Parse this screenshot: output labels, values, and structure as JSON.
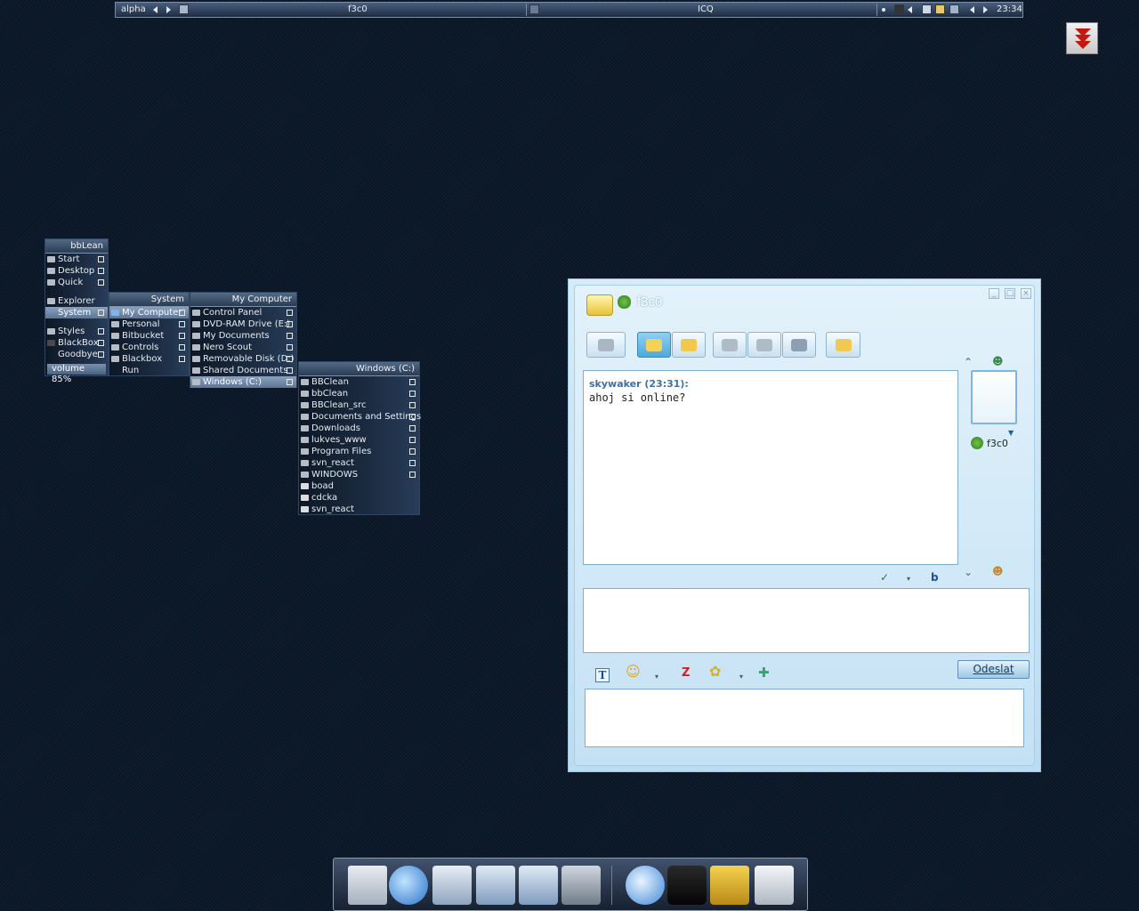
{
  "toolbar": {
    "workspace": "alpha",
    "task_title": "f3c0",
    "app_title": "ICQ",
    "clock": "23:34"
  },
  "menus": {
    "bblean": {
      "title": "bbLean",
      "items": [
        "Start",
        "Desktop",
        "Quick",
        "Explorer",
        "System",
        "Styles",
        "BlackBox",
        "Goodbye"
      ],
      "volume": "volume 85%"
    },
    "system": {
      "title": "System",
      "items": [
        "My Computer",
        "Personal",
        "Bitbucket",
        "Controls",
        "Blackbox",
        "Run"
      ]
    },
    "my_computer": {
      "title": "My Computer",
      "items": [
        "Control Panel",
        "DVD-RAM Drive (E:)",
        "My Documents",
        "Nero Scout",
        "Removable Disk (D:)",
        "Shared Documents",
        "Windows (C:)"
      ]
    },
    "windows_c": {
      "title": "Windows (C:)",
      "items": [
        "BBClean",
        "bbClean",
        "BBClean_src",
        "Documents and Settings",
        "Downloads",
        "lukves_www",
        "Program Files",
        "svn_react",
        "WINDOWS",
        "boad",
        "cdcka",
        "svn_react"
      ]
    }
  },
  "icq": {
    "title": "f3c0",
    "history": {
      "sender": "skywaker (23:31):",
      "message": "ahoj si online?"
    },
    "contact_name": "f3c0",
    "send_label": "Odeslat"
  },
  "colors": {
    "desktop": "#0c1a2b",
    "menu_selection": "#7189a8",
    "icq_frame": "#c4e1f4",
    "icq_accent": "#4ea9dc"
  }
}
